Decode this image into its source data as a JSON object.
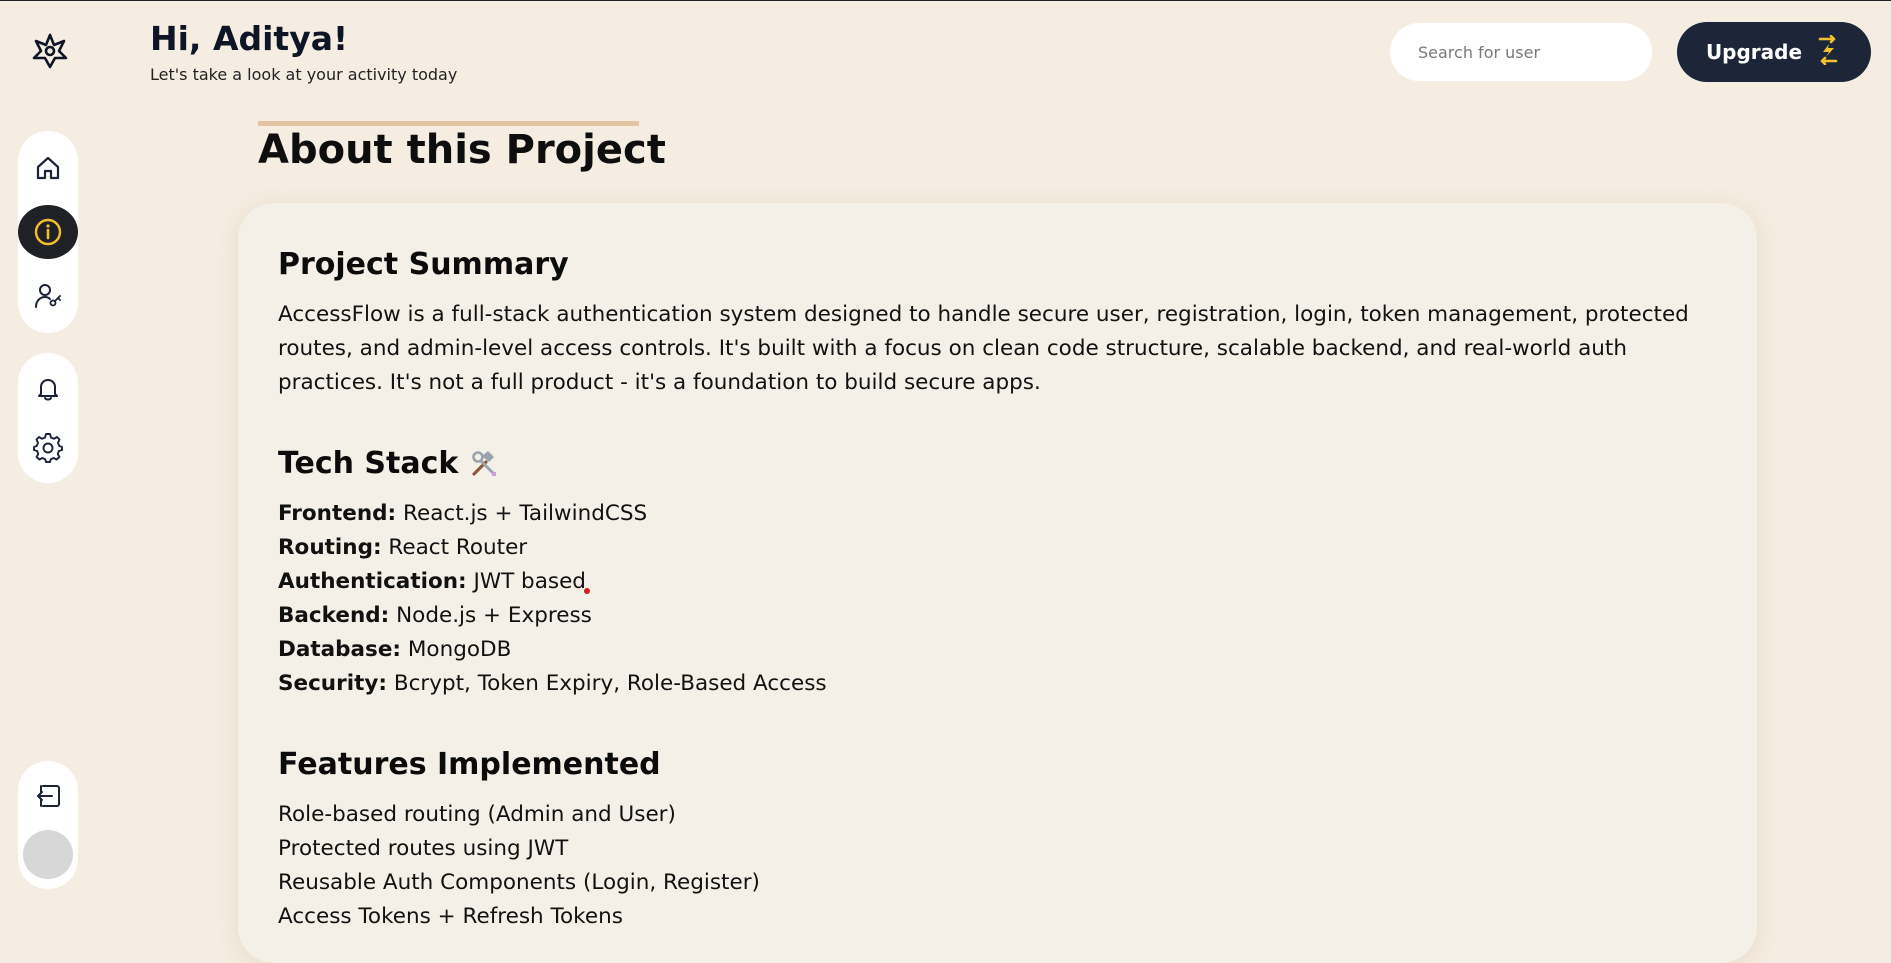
{
  "header": {
    "greeting": "Hi, Aditya!",
    "subtitle": "Let's take a look at your activity today",
    "search_placeholder": "Search for user",
    "upgrade_label": "Upgrade"
  },
  "sidebar": {
    "nav_top": [
      "home-icon",
      "info-icon",
      "user-key-icon"
    ],
    "nav_mid": [
      "bell-icon",
      "settings-icon"
    ],
    "nav_bottom": [
      "logout-icon",
      "avatar"
    ],
    "active": "info-icon"
  },
  "page": {
    "title": "About this Project"
  },
  "summary": {
    "heading": "Project Summary",
    "text": "AccessFlow is a full-stack authentication system designed to handle secure user, registration, login, token management, protected routes, and admin-level access controls. It's built with a focus on clean code structure, scalable backend, and real-world auth practices. It's not a full product - it's a foundation to build secure apps."
  },
  "tech_stack": {
    "heading": "Tech Stack",
    "icon": "hammer-wrench-icon",
    "items": [
      {
        "label": "Frontend:",
        "value": "React.js + TailwindCSS"
      },
      {
        "label": "Routing:",
        "value": "React Router"
      },
      {
        "label": "Authentication:",
        "value": "JWT based"
      },
      {
        "label": "Backend:",
        "value": "Node.js + Express"
      },
      {
        "label": "Database:",
        "value": "MongoDB"
      },
      {
        "label": "Security:",
        "value": "Bcrypt, Token Expiry, Role-Based Access"
      }
    ]
  },
  "features": {
    "heading": "Features Implemented",
    "items": [
      "Role-based routing (Admin and User)",
      "Protected routes using JWT",
      "Reusable Auth Components (Login, Register)",
      "Access Tokens + Refresh Tokens"
    ]
  },
  "colors": {
    "background": "#f5ede1",
    "dark": "#1c2638",
    "accent": "#f2c12e",
    "card": "#f5f0e7"
  }
}
